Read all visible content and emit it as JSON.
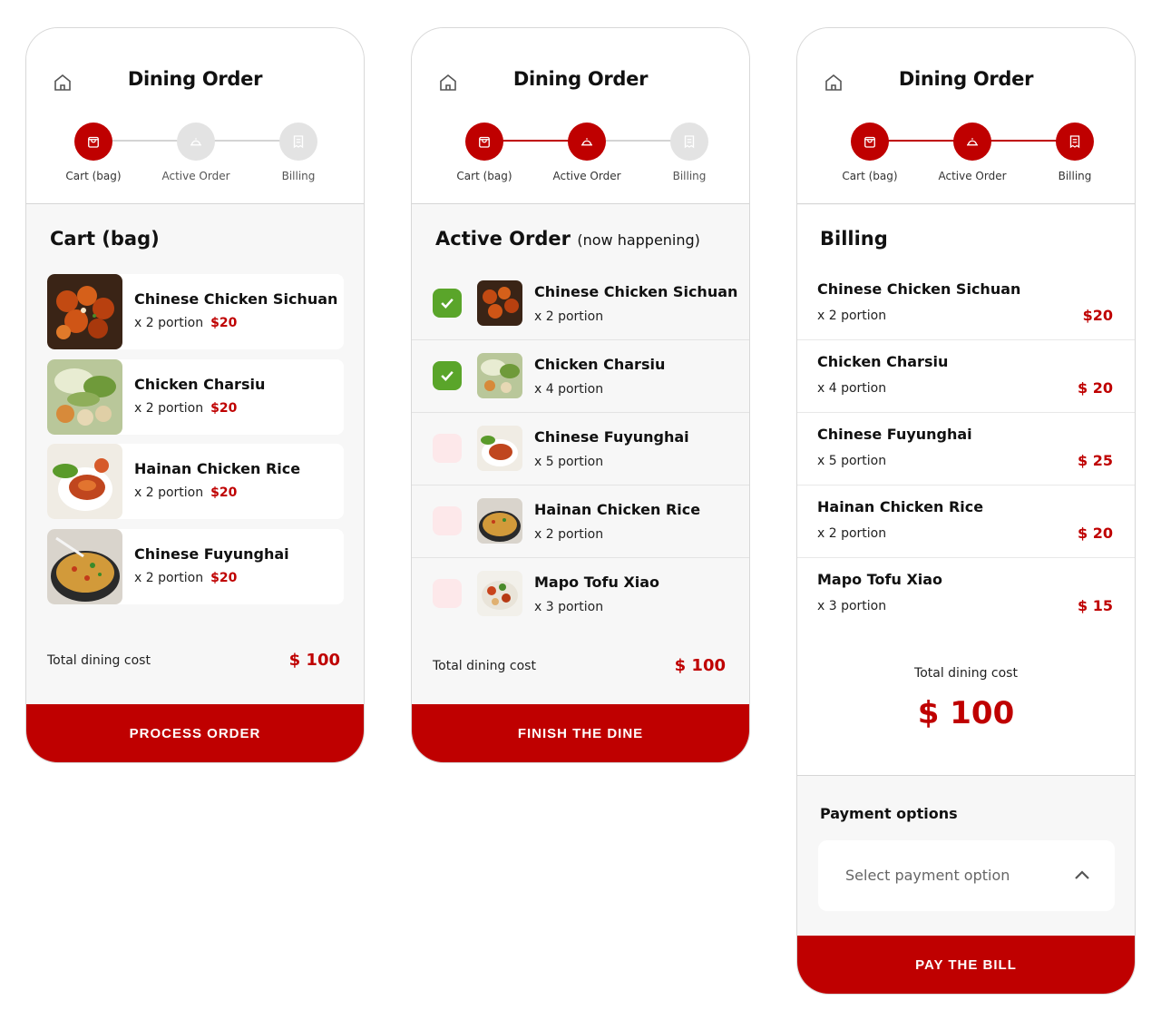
{
  "app": {
    "title": "Dining Order",
    "steps": [
      "Cart (bag)",
      "Active Order",
      "Billing"
    ],
    "total_label": "Total dining cost",
    "currency_colors": {
      "accent": "#bf0000",
      "check": "#5aa52a",
      "unchecked": "#fde8ea"
    }
  },
  "screen1": {
    "section_title": "Cart (bag)",
    "items": [
      {
        "name": "Chinese Chicken Sichuan",
        "portion": "x 2 portion",
        "price": "$20",
        "image": "fried-chicken"
      },
      {
        "name": "Chicken Charsiu",
        "portion": "x 2 portion",
        "price": "$20",
        "image": "charsiu-veggies"
      },
      {
        "name": "Hainan Chicken Rice",
        "portion": "x 2 portion",
        "price": "$20",
        "image": "chicken-rice"
      },
      {
        "name": "Chinese Fuyunghai",
        "portion": "x 2 portion",
        "price": "$20",
        "image": "fried-noodles"
      }
    ],
    "total": "$ 100",
    "cta": "PROCESS ORDER"
  },
  "screen2": {
    "section_title": "Active Order",
    "section_subtitle": "(now happening)",
    "items": [
      {
        "name": "Chinese Chicken Sichuan",
        "portion": "x 2 portion",
        "checked": true
      },
      {
        "name": "Chicken Charsiu",
        "portion": "x 4 portion",
        "checked": true
      },
      {
        "name": "Chinese Fuyunghai",
        "portion": "x 5 portion",
        "checked": false
      },
      {
        "name": "Hainan Chicken Rice",
        "portion": "x 2 portion",
        "checked": false
      },
      {
        "name": "Mapo Tofu Xiao",
        "portion": "x 3 portion",
        "checked": false
      }
    ],
    "total": "$ 100",
    "cta": "FINISH THE DINE"
  },
  "screen3": {
    "section_title": "Billing",
    "items": [
      {
        "name": "Chinese Chicken Sichuan",
        "portion": "x 2 portion",
        "price": "$20"
      },
      {
        "name": "Chicken Charsiu",
        "portion": "x 4 portion",
        "price": "$ 20"
      },
      {
        "name": "Chinese Fuyunghai",
        "portion": "x 5 portion",
        "price": "$ 25"
      },
      {
        "name": "Hainan Chicken Rice",
        "portion": "x 2 portion",
        "price": "$ 20"
      },
      {
        "name": "Mapo Tofu Xiao",
        "portion": "x 3 portion",
        "price": "$ 15"
      }
    ],
    "total": "$ 100",
    "payment_title": "Payment options",
    "payment_placeholder": "Select payment option",
    "cta": "PAY THE BILL"
  }
}
